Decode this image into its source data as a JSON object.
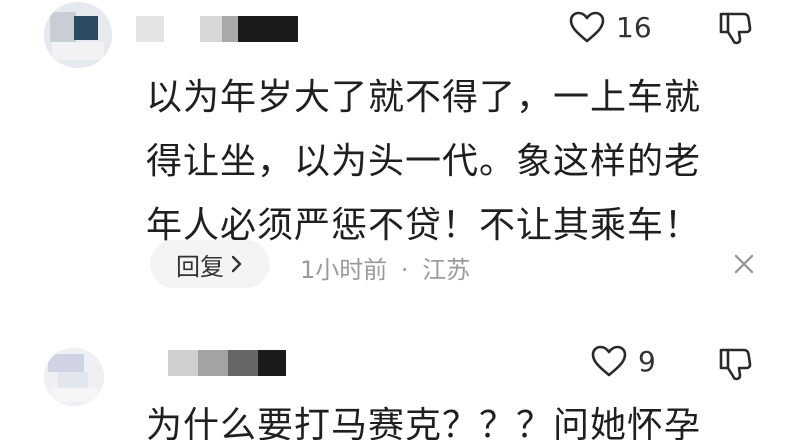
{
  "comments": [
    {
      "like_count": "16",
      "text_lines": [
        "以为年岁大了就不得了，一上车就",
        "得让坐，以为头一代。象这样的老",
        "年人必须严惩不贷！不让其乘车！"
      ],
      "reply_label": "回复",
      "time": "1小时前",
      "separator": "·",
      "location": "江苏"
    },
    {
      "like_count": "9",
      "text_lines": [
        "为什么要打马赛克？？？问她怀孕"
      ]
    }
  ],
  "icons": {
    "like": "heart-outline-icon",
    "dislike": "thumb-down-icon",
    "reply_arrow": "chevron-right-icon",
    "dismiss": "close-icon"
  },
  "colors": {
    "text": "#1f1f1f",
    "meta": "#9a9a9a",
    "reply_bg": "#f3f4f6"
  }
}
